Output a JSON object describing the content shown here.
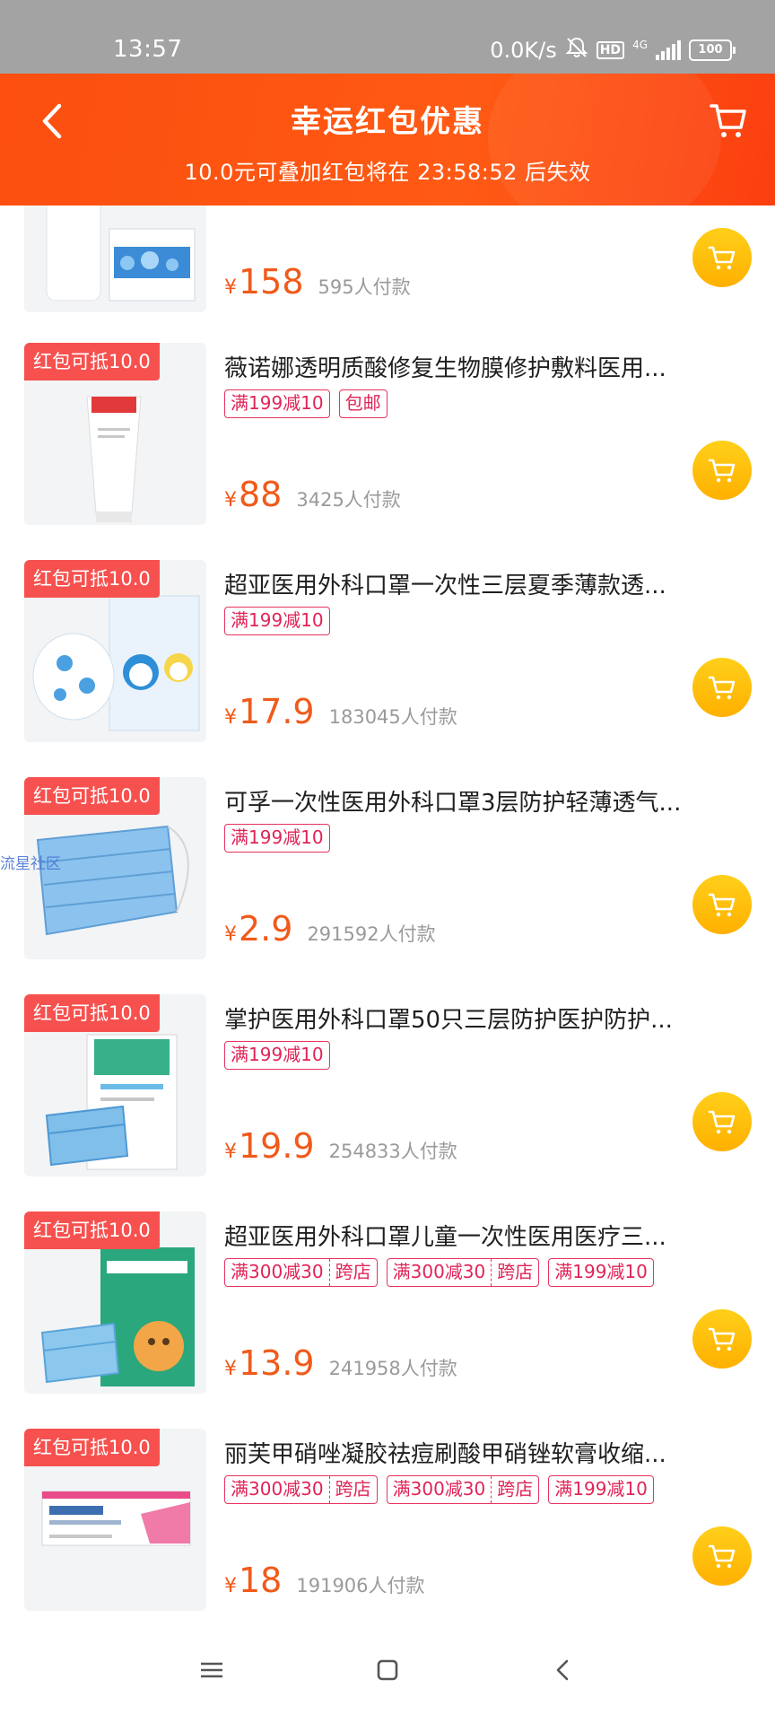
{
  "status_bar": {
    "time": "13:57",
    "net_speed": "0.0K/s",
    "hd": "HD",
    "network": "4G",
    "battery": "100"
  },
  "header": {
    "title": "幸运红包优惠",
    "countdown": "10.0元可叠加红包将在 23:58:52 后失效",
    "back_icon": "chevron-left-icon",
    "cart_icon": "shopping-cart-icon"
  },
  "colors": {
    "header_bg": "#fb4e0f",
    "price": "#f05a1a",
    "tag": "#e02457",
    "badge": "#f6514f",
    "cart_button": "#ffb000"
  },
  "products": [
    {
      "badge": "",
      "title": "",
      "tags": [],
      "price_symbol": "¥",
      "price": "158",
      "buyers": "595人付款"
    },
    {
      "badge": "红包可抵10.0",
      "title": "薇诺娜透明质酸修复生物膜修护敷料医用...",
      "tags": [
        "满199减10",
        "包邮"
      ],
      "price_symbol": "¥",
      "price": "88",
      "buyers": "3425人付款"
    },
    {
      "badge": "红包可抵10.0",
      "title": "超亚医用外科口罩一次性三层夏季薄款透...",
      "tags": [
        "满199减10"
      ],
      "price_symbol": "¥",
      "price": "17.9",
      "buyers": "183045人付款"
    },
    {
      "badge": "红包可抵10.0",
      "title": "可孚一次性医用外科口罩3层防护轻薄透气...",
      "tags": [
        "满199减10"
      ],
      "price_symbol": "¥",
      "price": "2.9",
      "buyers": "291592人付款"
    },
    {
      "badge": "红包可抵10.0",
      "title": "掌护医用外科口罩50只三层防护医护防护...",
      "tags": [
        "满199减10"
      ],
      "price_symbol": "¥",
      "price": "19.9",
      "buyers": "254833人付款"
    },
    {
      "badge": "红包可抵10.0",
      "title": "超亚医用外科口罩儿童一次性医用医疗三...",
      "split_tags": [
        [
          "满300减30",
          "跨店"
        ],
        [
          "满300减30",
          "跨店"
        ]
      ],
      "tags": [
        "满199减10"
      ],
      "price_symbol": "¥",
      "price": "13.9",
      "buyers": "241958人付款"
    },
    {
      "badge": "红包可抵10.0",
      "title": "丽芙甲硝唑凝胶祛痘刷酸甲硝锉软膏收缩...",
      "split_tags": [
        [
          "满300减30",
          "跨店"
        ],
        [
          "满300减30",
          "跨店"
        ]
      ],
      "tags": [
        "满199减10"
      ],
      "price_symbol": "¥",
      "price": "18",
      "buyers": "191906人付款"
    }
  ],
  "watermark": "流星社区",
  "nav_bar": {
    "menu_icon": "menu-icon",
    "home_icon": "home-square-icon",
    "back_icon": "back-triangle-icon"
  }
}
